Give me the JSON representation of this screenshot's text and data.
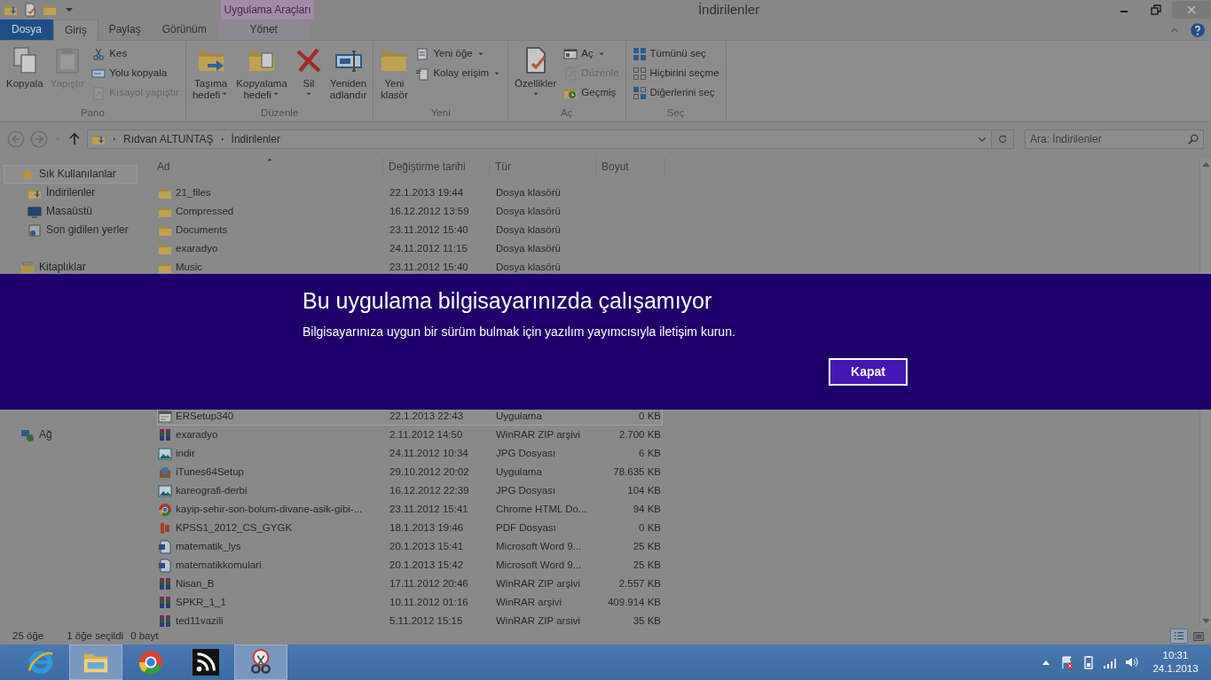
{
  "window": {
    "title": "İndirilenler"
  },
  "ribbon": {
    "contextual_header": "Uygulama Araçları",
    "tabs": [
      {
        "label": "Dosya",
        "kind": "file",
        "selected": false
      },
      {
        "label": "Giriş",
        "kind": "standard",
        "selected": true
      },
      {
        "label": "Paylaş",
        "kind": "standard",
        "selected": false
      },
      {
        "label": "Görünüm",
        "kind": "standard",
        "selected": false
      },
      {
        "label": "Yönet",
        "kind": "contextual",
        "selected": false
      }
    ],
    "groups": [
      {
        "label": "Pano",
        "items": [
          {
            "label": "Kopyala",
            "kind": "large",
            "disabled": false
          },
          {
            "label": "Yapıştır",
            "kind": "large",
            "disabled": true
          },
          {
            "label": "Kes",
            "kind": "small",
            "disabled": false
          },
          {
            "label": "Yolu kopyala",
            "kind": "small",
            "disabled": false
          },
          {
            "label": "Kısayol yapıştır",
            "kind": "small",
            "disabled": true
          }
        ]
      },
      {
        "label": "Düzenle",
        "items": [
          {
            "label": "Taşıma\nhedefi",
            "kind": "large",
            "disabled": false,
            "dropdown": true
          },
          {
            "label": "Kopyalama\nhedefi",
            "kind": "large",
            "disabled": false,
            "dropdown": true
          },
          {
            "label": "Sil",
            "kind": "large",
            "disabled": false,
            "dropdown": true,
            "caret_below": true
          },
          {
            "label": "Yeniden\nadlandır",
            "kind": "large",
            "disabled": false
          }
        ]
      },
      {
        "label": "Yeni",
        "items": [
          {
            "label": "Yeni\nklasör",
            "kind": "large",
            "disabled": false
          },
          {
            "label": "Yeni öğe",
            "kind": "small",
            "disabled": false,
            "dropdown": true
          },
          {
            "label": "Kolay erişim",
            "kind": "small",
            "disabled": false,
            "dropdown": true
          }
        ]
      },
      {
        "label": "Aç",
        "items": [
          {
            "label": "Özellikler",
            "kind": "large",
            "disabled": false,
            "dropdown": true,
            "caret_below": true
          },
          {
            "label": "Aç",
            "kind": "small",
            "disabled": false,
            "dropdown": true
          },
          {
            "label": "Düzenle",
            "kind": "small",
            "disabled": true
          },
          {
            "label": "Geçmiş",
            "kind": "small",
            "disabled": false
          }
        ]
      },
      {
        "label": "Seç",
        "items": [
          {
            "label": "Tümünü seç",
            "kind": "small",
            "disabled": false
          },
          {
            "label": "Hiçbirini seçme",
            "kind": "small",
            "disabled": false
          },
          {
            "label": "Diğerlerini seç",
            "kind": "small",
            "disabled": false
          }
        ]
      }
    ]
  },
  "address": {
    "path": [
      "Rıdvan ALTUNTAŞ",
      "İndirilenler"
    ]
  },
  "search": {
    "placeholder": "Ara: İndirilenler"
  },
  "sidebar": {
    "sections": [
      {
        "label": "Sık Kullanılanlar",
        "kind": "favorites",
        "selected": true,
        "children": [
          {
            "label": "İndirilenler",
            "kind": "downloads",
            "selected": false
          },
          {
            "label": "Masaüstü",
            "kind": "desktop",
            "selected": false
          },
          {
            "label": "Son gidilen yerler",
            "kind": "recent",
            "selected": false
          }
        ]
      },
      {
        "label": "Kitaplıklar",
        "kind": "libraries",
        "selected": false
      },
      {
        "label": "Ağ",
        "kind": "network",
        "selected": false
      }
    ]
  },
  "table": {
    "columns": [
      {
        "label": "Ad",
        "sorted": true
      },
      {
        "label": "Değiştirme tarihi",
        "sorted": false
      },
      {
        "label": "Tür",
        "sorted": false
      },
      {
        "label": "Boyut",
        "sorted": false
      }
    ],
    "rows_top": [
      {
        "name": "21_files",
        "date": "22.1.2013 19:44",
        "type": "Dosya klasörü",
        "kind": "folder",
        "selected": false
      },
      {
        "name": "Compressed",
        "date": "16.12.2012 13:59",
        "type": "Dosya klasörü",
        "kind": "folder",
        "selected": false
      },
      {
        "name": "Documents",
        "date": "23.11.2012 15:40",
        "type": "Dosya klasörü",
        "kind": "folder",
        "selected": false
      },
      {
        "name": "exaradyo",
        "date": "24.11.2012 11:15",
        "type": "Dosya klasörü",
        "kind": "folder",
        "selected": false
      },
      {
        "name": "Music",
        "date": "23.11.2012 15:40",
        "type": "Dosya klasörü",
        "kind": "folder",
        "selected": false
      }
    ],
    "rows_bottom": [
      {
        "name": "ERSetup340",
        "date": "22.1.2013 22:43",
        "type": "Uygulama",
        "size": "0 KB",
        "kind": "application",
        "selected": true
      },
      {
        "name": "exaradyo",
        "date": "2.11.2012 14:50",
        "type": "WinRAR ZIP arşivi",
        "size": "2.700 KB",
        "kind": "archive",
        "selected": false
      },
      {
        "name": "indir",
        "date": "24.11.2012 10:34",
        "type": "JPG Dosyası",
        "size": "6 KB",
        "kind": "image",
        "selected": false
      },
      {
        "name": "iTunes64Setup",
        "date": "29.10.2012 20:02",
        "type": "Uygulama",
        "size": "78.635 KB",
        "kind": "installer",
        "selected": false
      },
      {
        "name": "kareografi-derbi",
        "date": "16.12.2012 22:39",
        "type": "JPG Dosyası",
        "size": "104 KB",
        "kind": "image",
        "selected": false
      },
      {
        "name": "kayip-sehir-son-bolum-divane-asik-gibi-...",
        "date": "23.11.2012 15:41",
        "type": "Chrome HTML Do...",
        "size": "94 KB",
        "kind": "web",
        "selected": false
      },
      {
        "name": "KPSS1_2012_CS_GYGK",
        "date": "18.1.2013 19:46",
        "type": "PDF Dosyası",
        "size": "0 KB",
        "kind": "pdf",
        "selected": false
      },
      {
        "name": "matematik_lys",
        "date": "20.1.2013 15:41",
        "type": "Microsoft Word 9...",
        "size": "25 KB",
        "kind": "document",
        "selected": false
      },
      {
        "name": "matematikkomulari",
        "date": "20.1.2013 15:42",
        "type": "Microsoft Word 9...",
        "size": "25 KB",
        "kind": "document",
        "selected": false
      },
      {
        "name": "Nisan_B",
        "date": "17.11.2012 20:46",
        "type": "WinRAR ZIP arşivi",
        "size": "2.557 KB",
        "kind": "archive",
        "selected": false
      },
      {
        "name": "SPKR_1_1",
        "date": "10.11.2012 01:16",
        "type": "WinRAR arşivi",
        "size": "409.914 KB",
        "kind": "archive",
        "selected": false
      },
      {
        "name": "ted11vazili",
        "date": "5.11.2012 15:15",
        "type": "WinRAR ZIP arsivi",
        "size": "35 KB",
        "kind": "archive",
        "selected": false
      }
    ]
  },
  "status_bar": {
    "item_count": "25 öğe",
    "selection": "1 öğe seçildi",
    "selection_size": "0 bayt",
    "views": [
      {
        "kind": "details",
        "selected": true
      },
      {
        "kind": "icons",
        "selected": false
      }
    ]
  },
  "dialog": {
    "title": "Bu uygulama bilgisayarınızda çalışamıyor",
    "message": "Bilgisayarınıza uygun bir sürüm bulmak için yazılım yayımcısıyla iletişim kurun.",
    "button": "Kapat"
  },
  "taskbar": {
    "apps": [
      {
        "kind": "e-browser",
        "selected": false
      },
      {
        "kind": "folders",
        "selected": true
      },
      {
        "kind": "ring-browser",
        "selected": false
      },
      {
        "kind": "feed",
        "selected": false
      },
      {
        "kind": "scissors",
        "selected": true
      }
    ],
    "time": "10:31",
    "date": "24.1.2013"
  }
}
